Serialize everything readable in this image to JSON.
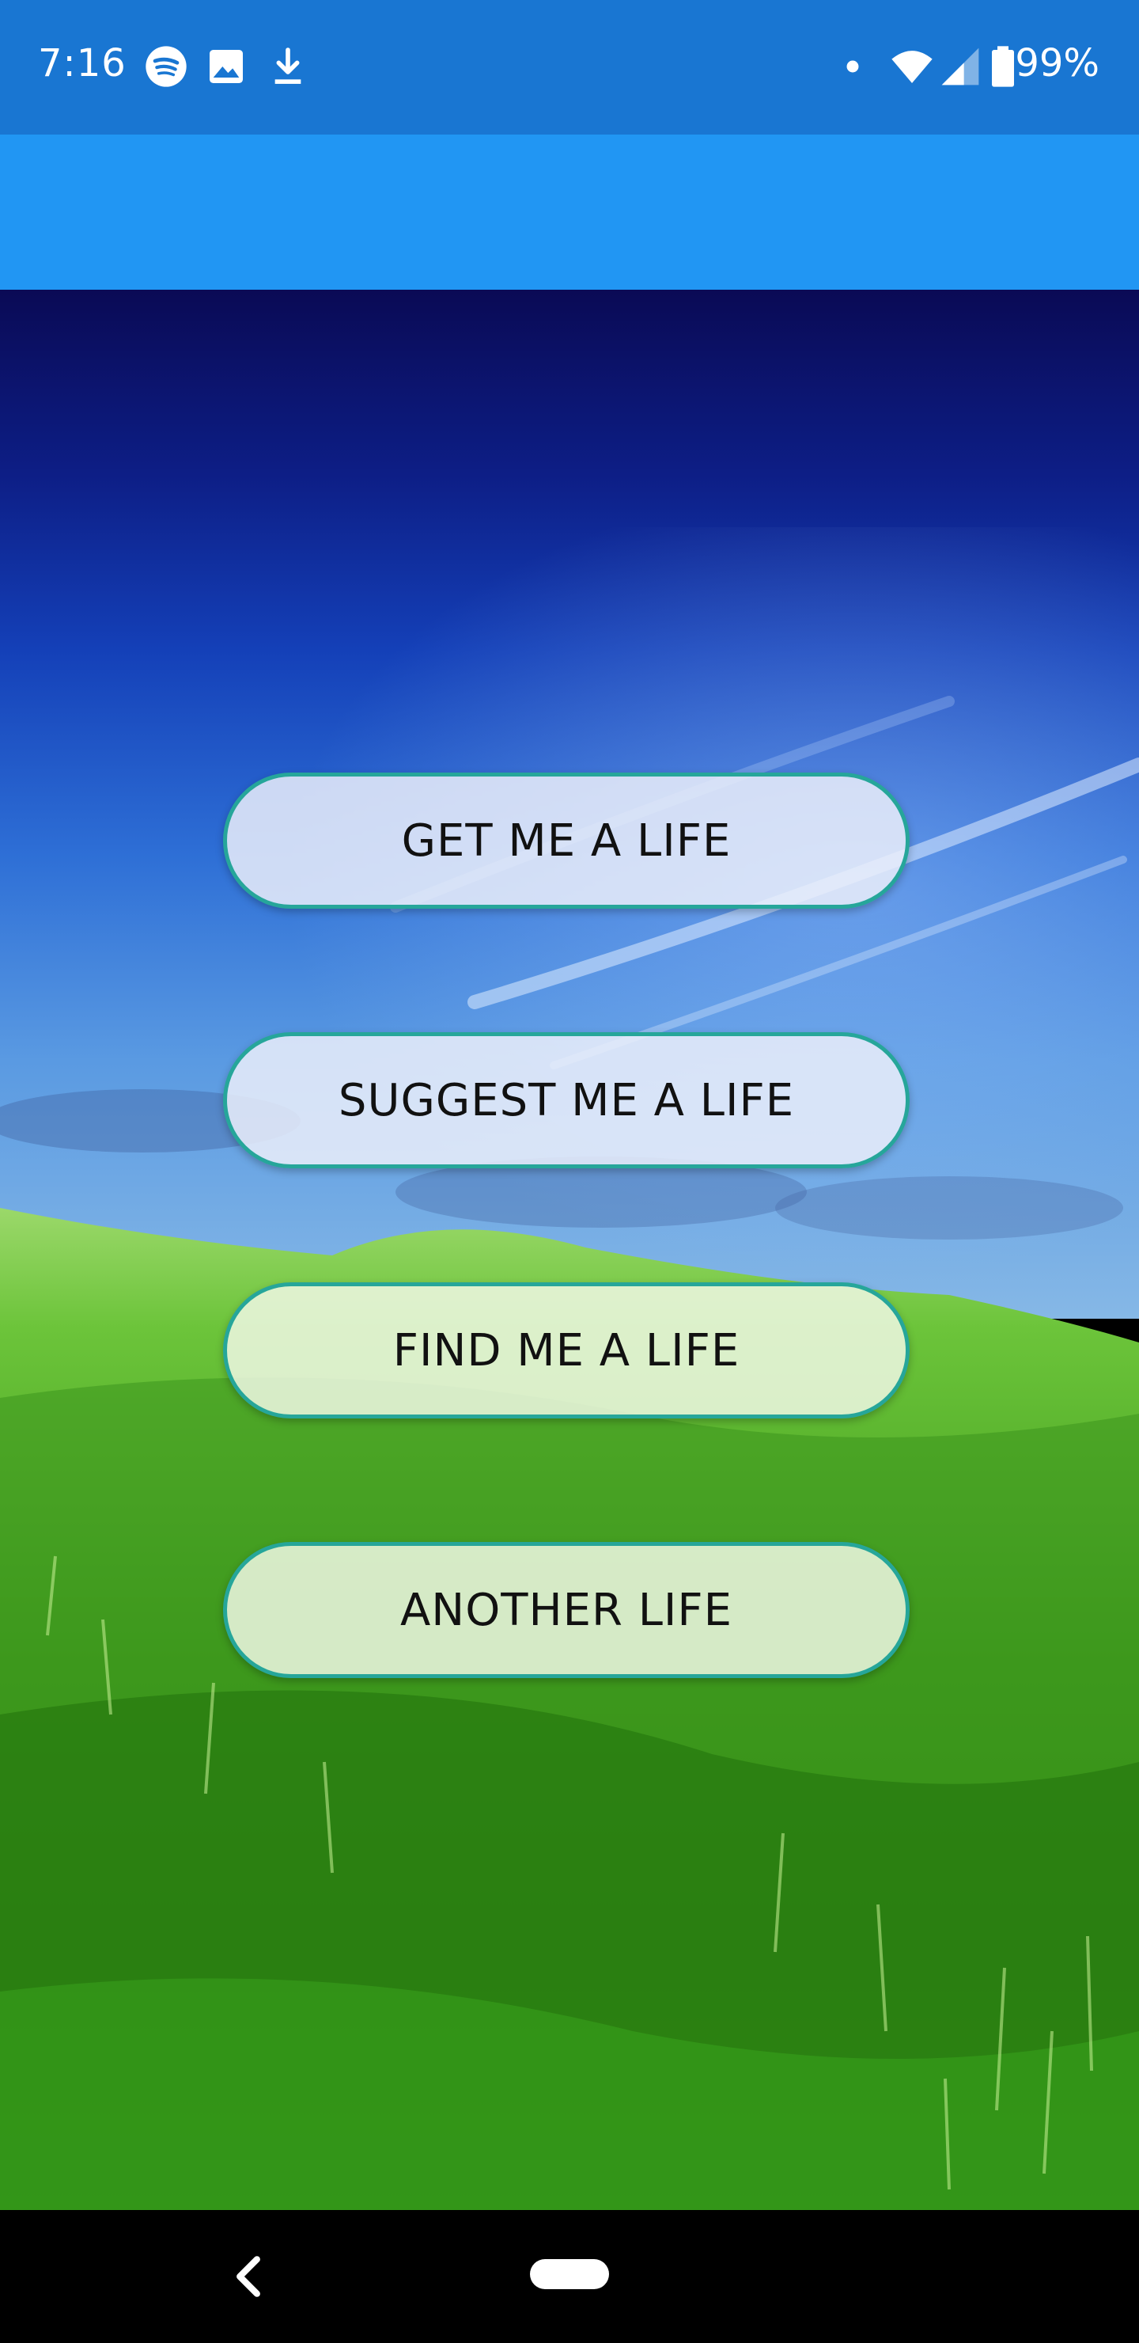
{
  "status_bar": {
    "time": "7:16",
    "battery": "99%",
    "icons": [
      "spotify-icon",
      "image-icon",
      "download-icon",
      "notification-dot-icon",
      "wifi-icon",
      "signal-icon",
      "battery-icon"
    ]
  },
  "buttons": [
    {
      "label": "GET ME A LIFE"
    },
    {
      "label": "SUGGEST ME A LIFE"
    },
    {
      "label": "FIND ME A LIFE"
    },
    {
      "label": "ANOTHER LIFE"
    }
  ],
  "colors": {
    "status_bar": "#1976d2",
    "app_bar": "#2196f3",
    "button_border": "#26a69a"
  }
}
